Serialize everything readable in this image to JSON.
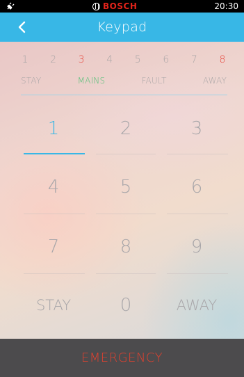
{
  "status_bar": {
    "brand": "BOSCH",
    "time": "20:30",
    "plug_icon": "plug-icon",
    "brand_logo": "bosch-logo",
    "colors": {
      "brand": "#e2231a"
    }
  },
  "header": {
    "title": "Keypad",
    "back_icon": "chevron-left-icon",
    "background_color": "#38b7e6"
  },
  "zones": [
    {
      "label": "1",
      "active": false
    },
    {
      "label": "2",
      "active": false
    },
    {
      "label": "3",
      "active": true
    },
    {
      "label": "4",
      "active": false
    },
    {
      "label": "5",
      "active": false
    },
    {
      "label": "6",
      "active": false
    },
    {
      "label": "7",
      "active": false
    },
    {
      "label": "8",
      "active": true
    }
  ],
  "states": [
    {
      "label": "STAY",
      "active": false
    },
    {
      "label": "MAINS",
      "active": true
    },
    {
      "label": "FAULT",
      "active": false
    },
    {
      "label": "AWAY",
      "active": false
    }
  ],
  "keypad": {
    "k1": "1",
    "k2": "2",
    "k3": "3",
    "k4": "4",
    "k5": "5",
    "k6": "6",
    "k7": "7",
    "k8": "8",
    "k9": "9",
    "stay": "STAY",
    "k0": "0",
    "away": "AWAY",
    "selected_key": "1"
  },
  "emergency": {
    "label": "EMERGENCY",
    "color": "#e2412f"
  },
  "colors": {
    "accent": "#38b7e6",
    "zone_active": "#e8453a",
    "state_active": "#4bbf72"
  }
}
